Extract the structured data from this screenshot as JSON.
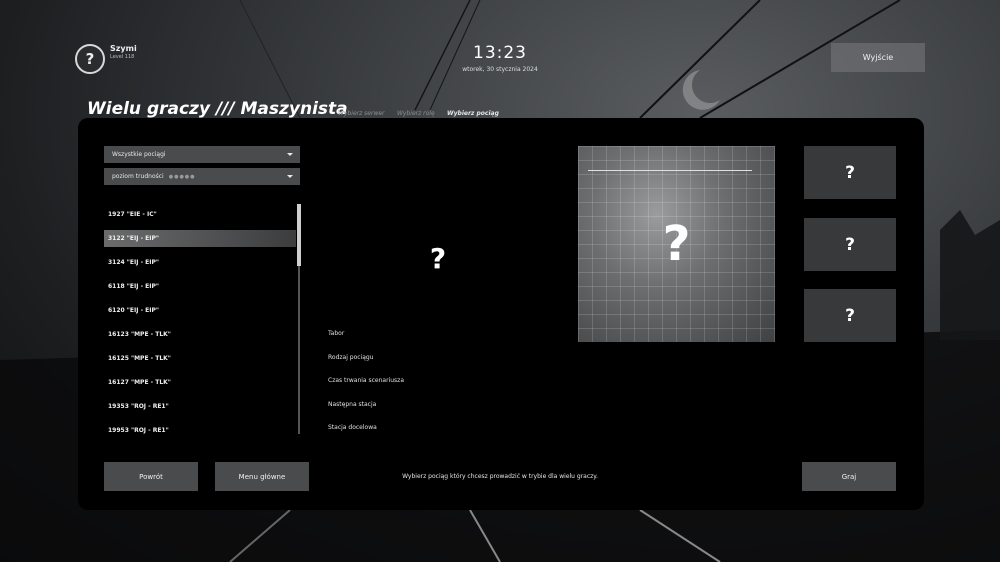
{
  "header": {
    "user_name": "Szymi",
    "user_level": "Level 118",
    "time": "13:23",
    "date": "wtorek, 30 stycznia 2024",
    "exit_label": "Wyjście",
    "avatar_icon": "question-mark-icon"
  },
  "title": "Wielu graczy /// Maszynista",
  "steps": [
    "Wybierz serwer",
    "Wybierz rolę",
    "Wybierz pociąg"
  ],
  "filters": {
    "category": "Wszystkie pociągi",
    "difficulty": "poziom trudności",
    "difficulty_dots": "●●●●●"
  },
  "trains": [
    "1927 \"EIE - IC\"",
    "3122 \"EIJ - EIP\"",
    "3124 \"EIJ - EIP\"",
    "6118 \"EIJ - EIP\"",
    "6120 \"EIJ - EIP\"",
    "16123 \"MPE - TLK\"",
    "16125 \"MPE - TLK\"",
    "16127 \"MPE - TLK\"",
    "19353 \"ROJ - RE1\"",
    "19953 \"ROJ - RE1\""
  ],
  "selected_train_index": 1,
  "detail": {
    "placeholder": "?",
    "labels": [
      "Tabor",
      "Rodzaj pociągu",
      "Czas trwania scenariusza",
      "Następna stacja",
      "Stacja docelowa"
    ],
    "preview_placeholder": "?",
    "thumbnails": [
      "?",
      "?",
      "?"
    ]
  },
  "footer": {
    "back_label": "Powrót",
    "main_menu_label": "Menu główne",
    "hint": "Wybierz pociąg który chcesz prowadzić w trybie dla wielu graczy.",
    "play_label": "Graj"
  },
  "colors": {
    "panel": "#000000",
    "button": "#4a4b4c",
    "thumbnail": "#38393a"
  }
}
